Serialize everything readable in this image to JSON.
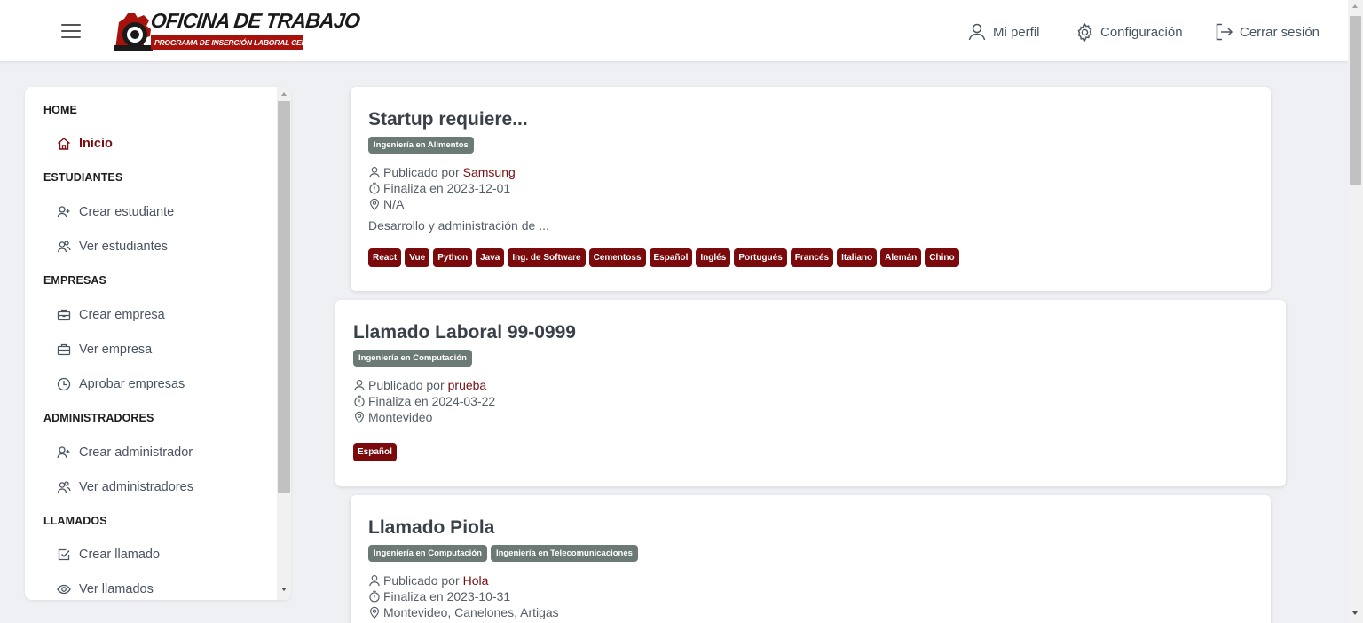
{
  "header": {
    "logo_title": "OFICINA DE TRABAJO",
    "logo_subtitle": "PROGRAMA DE INSERCIÓN LABORAL   CEI - FI",
    "nav": {
      "profile": "Mi perfil",
      "settings": "Configuración",
      "logout": "Cerrar sesión"
    }
  },
  "sidebar": {
    "sections": [
      {
        "title": "HOME",
        "items": [
          {
            "label": "Inicio",
            "icon": "home-icon",
            "active": true
          }
        ]
      },
      {
        "title": "ESTUDIANTES",
        "items": [
          {
            "label": "Crear estudiante",
            "icon": "user-plus-icon"
          },
          {
            "label": "Ver estudiantes",
            "icon": "users-icon"
          }
        ]
      },
      {
        "title": "EMPRESAS",
        "items": [
          {
            "label": "Crear empresa",
            "icon": "briefcase-icon"
          },
          {
            "label": "Ver empresa",
            "icon": "briefcase-icon"
          },
          {
            "label": "Aprobar empresas",
            "icon": "clock-icon"
          }
        ]
      },
      {
        "title": "ADMINISTRADORES",
        "items": [
          {
            "label": "Crear administrador",
            "icon": "user-plus-icon"
          },
          {
            "label": "Ver administradores",
            "icon": "users-icon"
          }
        ]
      },
      {
        "title": "LLAMADOS",
        "items": [
          {
            "label": "Crear llamado",
            "icon": "checkbox-icon"
          },
          {
            "label": "Ver llamados",
            "icon": "eye-icon"
          }
        ]
      }
    ]
  },
  "labels": {
    "published_by": "Publicado por",
    "ends_on": "Finaliza en"
  },
  "cards": [
    {
      "title": "Startup requiere...",
      "careers": [
        "Ingeniería en Alimentos"
      ],
      "publisher": "Samsung",
      "end_date": "2023-12-01",
      "location": "N/A",
      "description": "Desarrollo y administración de ...",
      "skills": [
        "React",
        "Vue",
        "Python",
        "Java",
        "Ing. de Software",
        "Cementoss",
        "Español",
        "Inglés",
        "Portugués",
        "Francés",
        "Italiano",
        "Alemán",
        "Chino"
      ]
    },
    {
      "title": "Llamado Laboral 99-0999",
      "careers": [
        "Ingeniería en Computación"
      ],
      "publisher": "prueba",
      "end_date": "2024-03-22",
      "location": "Montevideo",
      "description": "",
      "skills": [
        "Español"
      ]
    },
    {
      "title": "Llamado Piola",
      "careers": [
        "Ingeniería en Computación",
        "Ingeniería en Telecomunicaciones"
      ],
      "publisher": "Hola",
      "end_date": "2023-10-31",
      "location": "Montevideo, Canelones, Artigas",
      "description": "",
      "skills": []
    }
  ],
  "colors": {
    "brand": "#7a0e10",
    "career_tag": "#6b7a74",
    "skill_tag": "#7a0a0c"
  }
}
